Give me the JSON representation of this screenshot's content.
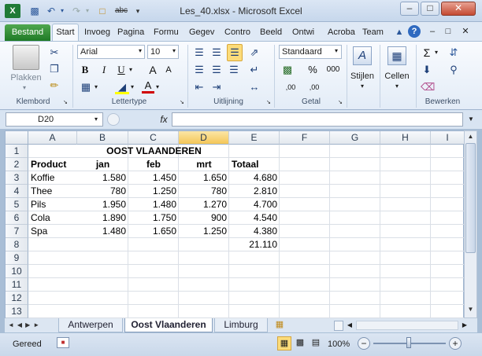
{
  "window": {
    "title": "Les_40.xlsx - Microsoft Excel"
  },
  "quick_access": {
    "undo": "↶",
    "redo": "↷",
    "spelling": "abc"
  },
  "ribbon_tabs": [
    "Bestand",
    "Start",
    "Invoeg",
    "Pagina",
    "Formu",
    "Gegev",
    "Contro",
    "Beeld",
    "Ontwi",
    "Acroba",
    "Team"
  ],
  "ribbon": {
    "clipboard": {
      "paste": "Plakken",
      "label": "Klembord"
    },
    "font": {
      "name": "Arial",
      "size": "10",
      "bold": "B",
      "italic": "I",
      "underline": "U",
      "grow": "A",
      "shrink": "A",
      "font_color_letter": "A",
      "label": "Lettertype"
    },
    "alignment": {
      "label": "Uitlijning"
    },
    "number": {
      "format": "Standaard",
      "percent": "%",
      "thousands": "000",
      "inc_decimals": ",00",
      "dec_decimals": ",00",
      "label": "Getal"
    },
    "styles": {
      "label": "Stijlen"
    },
    "cells": {
      "label": "Cellen"
    },
    "editing": {
      "sum": "Σ",
      "label": "Bewerken"
    }
  },
  "formula_bar": {
    "name_box": "D20",
    "fx": "fx",
    "formula": ""
  },
  "columns": [
    "A",
    "B",
    "C",
    "D",
    "E",
    "F",
    "G",
    "H",
    "I"
  ],
  "rows": [
    "1",
    "2",
    "3",
    "4",
    "5",
    "6",
    "7",
    "8",
    "9",
    "10",
    "11",
    "12",
    "13"
  ],
  "sheet": {
    "title": "OOST VLAANDEREN",
    "headers": [
      "Product",
      "jan",
      "feb",
      "mrt",
      "Totaal"
    ],
    "data": [
      [
        "Koffie",
        "1.580",
        "1.450",
        "1.650",
        "4.680"
      ],
      [
        "Thee",
        "780",
        "1.250",
        "780",
        "2.810"
      ],
      [
        "Pils",
        "1.950",
        "1.480",
        "1.270",
        "4.700"
      ],
      [
        "Cola",
        "1.890",
        "1.750",
        "900",
        "4.540"
      ],
      [
        "Spa",
        "1.480",
        "1.650",
        "1.250",
        "4.380"
      ]
    ],
    "grand_total": "21.110"
  },
  "sheet_tabs": [
    "Antwerpen",
    "Oost Vlaanderen",
    "Limburg"
  ],
  "status_bar": {
    "mode": "Gereed",
    "zoom": "100%"
  }
}
